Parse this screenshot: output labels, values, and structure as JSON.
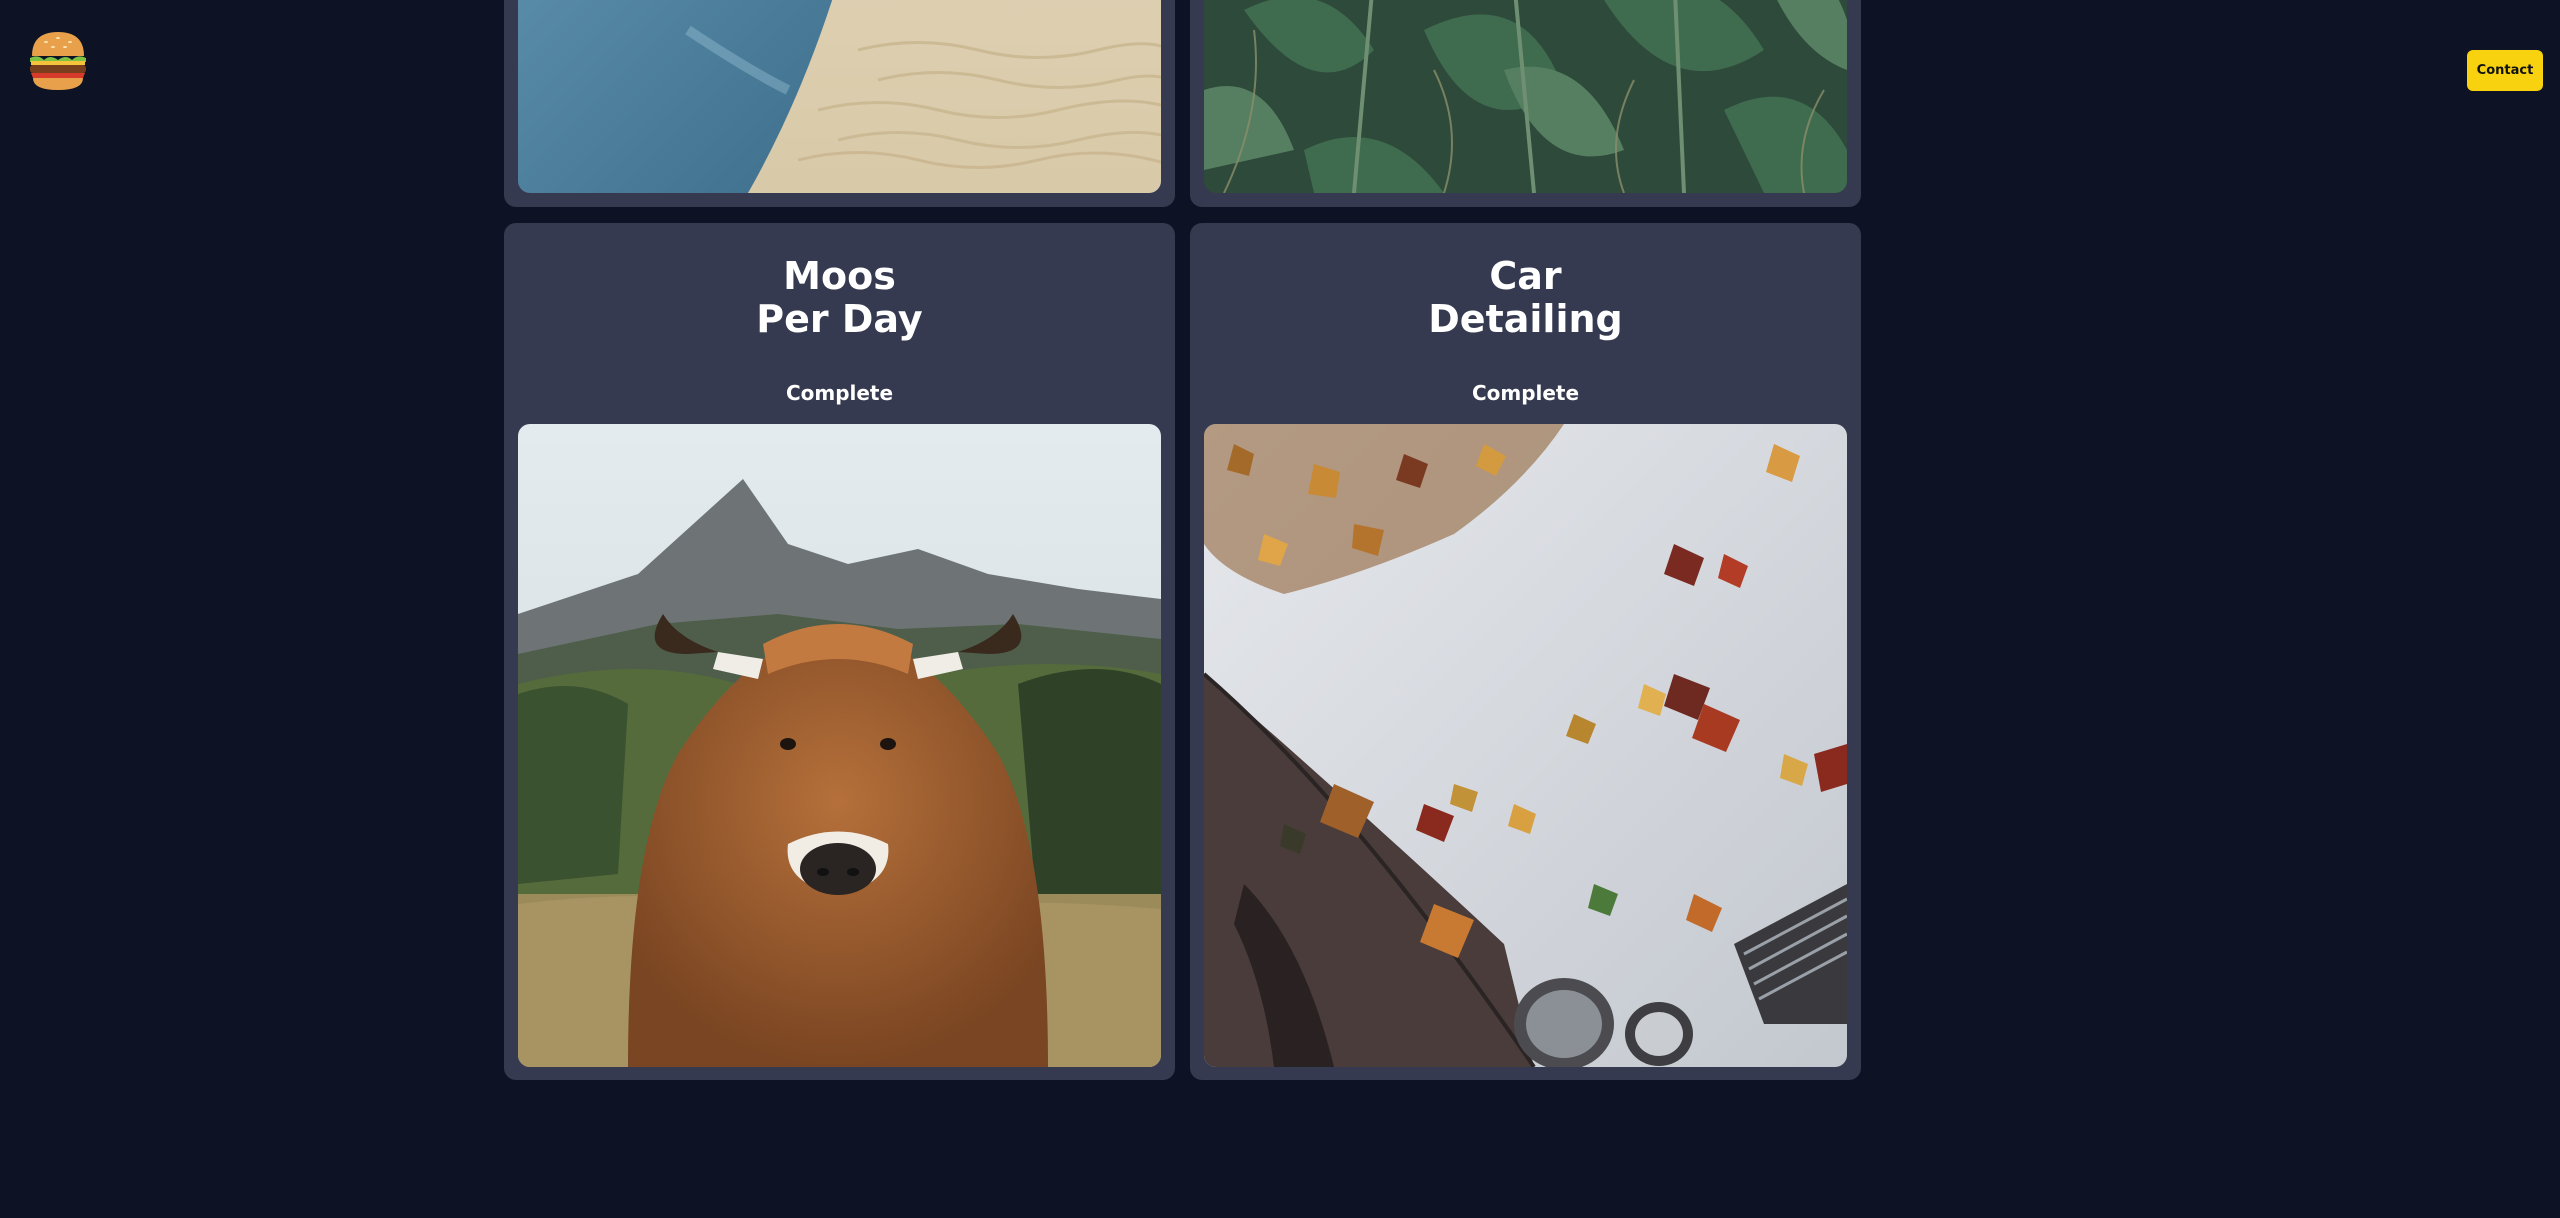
{
  "header": {
    "logo_icon": "hamburger-emoji-icon",
    "contact_label": "Contact",
    "contact_color": "#f8d20e"
  },
  "cards": [
    {
      "image_icon": "sand-dunes-water-photo"
    },
    {
      "image_icon": "sunflower-leaves-photo"
    },
    {
      "title_line1": "Moos",
      "title_line2": "Per Day",
      "status": "Complete",
      "image_icon": "highland-cow-photo"
    },
    {
      "title_line1": "Car",
      "title_line2": "Detailing",
      "status": "Complete",
      "image_icon": "autumn-leaves-car-photo"
    }
  ],
  "colors": {
    "background": "#0d1224",
    "card": "#363a50"
  }
}
